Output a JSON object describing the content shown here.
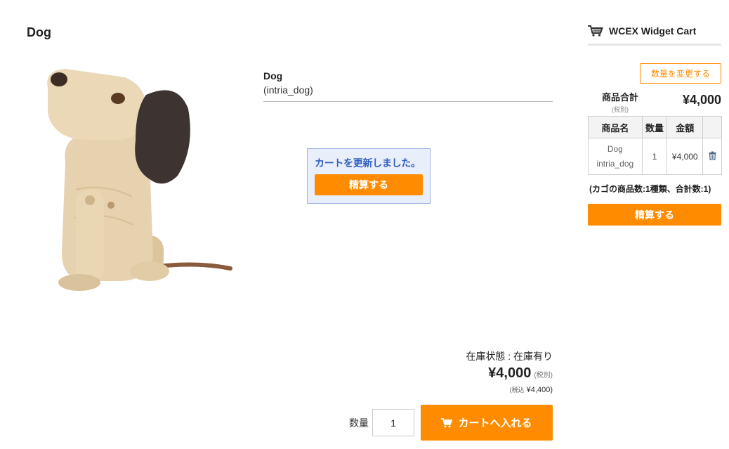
{
  "page": {
    "title": "Dog"
  },
  "product": {
    "name": "Dog",
    "code": "(intria_dog)",
    "image_alt": "wooden dog figurine",
    "stock_label": "在庫状態 : 在庫有り",
    "price": "¥4,000",
    "price_note": "(税別)",
    "tax_prefix": "(税込",
    "tax_value": " ¥4,400)",
    "qty_label": "数量",
    "qty_value": "1",
    "add_to_cart_label": "カートへ入れる"
  },
  "popup": {
    "message": "カートを更新しました。",
    "checkout_label": "精算する"
  },
  "widget_cart": {
    "title": "WCEX Widget Cart",
    "change_qty_label": "数量を変更する",
    "subtotal_label": "商品合計",
    "subtotal_note": "(税別)",
    "subtotal_value": "¥4,000",
    "columns": [
      "商品名",
      "数量",
      "金額"
    ],
    "rows": [
      {
        "name": "Dog",
        "code": "intria_dog",
        "qty": "1",
        "amount": "¥4,000"
      }
    ],
    "summary": "(カゴの商品数:1種類、合計数:1)",
    "checkout_label": "精算する"
  },
  "colors": {
    "accent": "#ff8c00",
    "popup_bg": "#e9eefb",
    "popup_text": "#2f5fbf"
  },
  "icons": {
    "cart": "cart-icon",
    "trash": "trash-icon"
  }
}
